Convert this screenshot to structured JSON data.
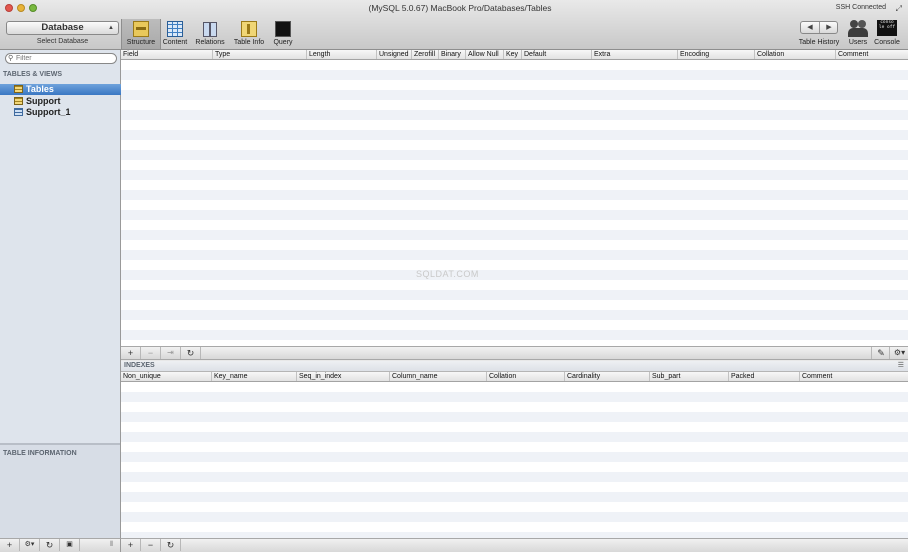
{
  "window": {
    "title": "(MySQL 5.0.67)  MacBook Pro/Databases/Tables",
    "ssh_status": "SSH Connected"
  },
  "toolbar": {
    "database_select": "Database",
    "database_caption": "Select Database",
    "buttons": [
      {
        "label": "Structure",
        "icon": "structure-icon",
        "active": true
      },
      {
        "label": "Content",
        "icon": "content-icon"
      },
      {
        "label": "Relations",
        "icon": "relations-icon"
      },
      {
        "label": "Table Info",
        "icon": "table-info-icon"
      },
      {
        "label": "Query",
        "icon": "query-icon"
      }
    ],
    "table_history_label": "Table History",
    "users_label": "Users",
    "console_label": "Console",
    "console_icon_text": "conso le off"
  },
  "sidebar": {
    "filter_placeholder": "Filter",
    "section_title": "TABLES & VIEWS",
    "items": [
      {
        "label": "Tables",
        "selected": true,
        "icon": "table-icon"
      },
      {
        "label": "Support",
        "selected": false,
        "icon": "table-icon"
      },
      {
        "label": "Support_1",
        "selected": false,
        "icon": "view-icon"
      }
    ],
    "info_title": "TABLE INFORMATION"
  },
  "structure": {
    "columns": [
      "Field",
      "Type",
      "Length",
      "Unsigned",
      "Zerofill",
      "Binary",
      "Allow Null",
      "Key",
      "Default",
      "Extra",
      "Encoding",
      "Collation",
      "Comment"
    ]
  },
  "indexes": {
    "title": "INDEXES",
    "columns": [
      "Non_unique",
      "Key_name",
      "Seq_in_index",
      "Column_name",
      "Collation",
      "Cardinality",
      "Sub_part",
      "Packed",
      "Comment"
    ]
  },
  "watermark": "SQLDAT.COM",
  "colors": {
    "selection": "#3a77c3",
    "sidebar_bg": "#dee4ec",
    "row_alt": "#eff2f7"
  }
}
